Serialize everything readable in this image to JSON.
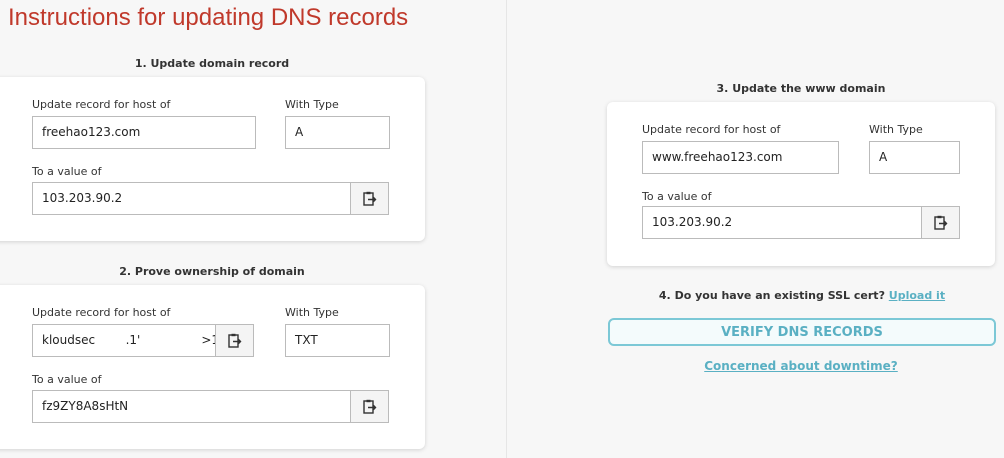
{
  "page": {
    "title": "Instructions for updating DNS records"
  },
  "section1": {
    "title": "1. Update domain record",
    "host_label": "Update record for host of",
    "host_value": "freehao123.com",
    "type_label": "With Type",
    "type_value": "A",
    "value_label": "To a value of",
    "value_value": "103.203.90.2",
    "copy_icon": "clipboard-copy-icon"
  },
  "section2": {
    "title": "2. Prove ownership of domain",
    "host_label": "Update record for host of",
    "host_value": "kloudsec        .1'                >1",
    "type_label": "With Type",
    "type_value": "TXT",
    "value_label": "To a value of",
    "value_value": "fz9ZY8A8sHtN",
    "copy_icon": "clipboard-copy-icon"
  },
  "section3": {
    "title": "3. Update the www domain",
    "host_label": "Update record for host of",
    "host_value": "www.freehao123.com",
    "type_label": "With Type",
    "type_value": "A",
    "value_label": "To a value of",
    "value_value": "103.203.90.2",
    "copy_icon": "clipboard-copy-icon"
  },
  "section4": {
    "question": "4. Do you have an existing SSL cert?",
    "upload_link": "Upload it"
  },
  "actions": {
    "verify_label": "VERIFY DNS RECORDS",
    "downtime_link": "Concerned about downtime?"
  },
  "colors": {
    "title_red": "#c0392b",
    "accent_teal": "#5ab0c3",
    "verify_border": "#7cc8d6"
  }
}
